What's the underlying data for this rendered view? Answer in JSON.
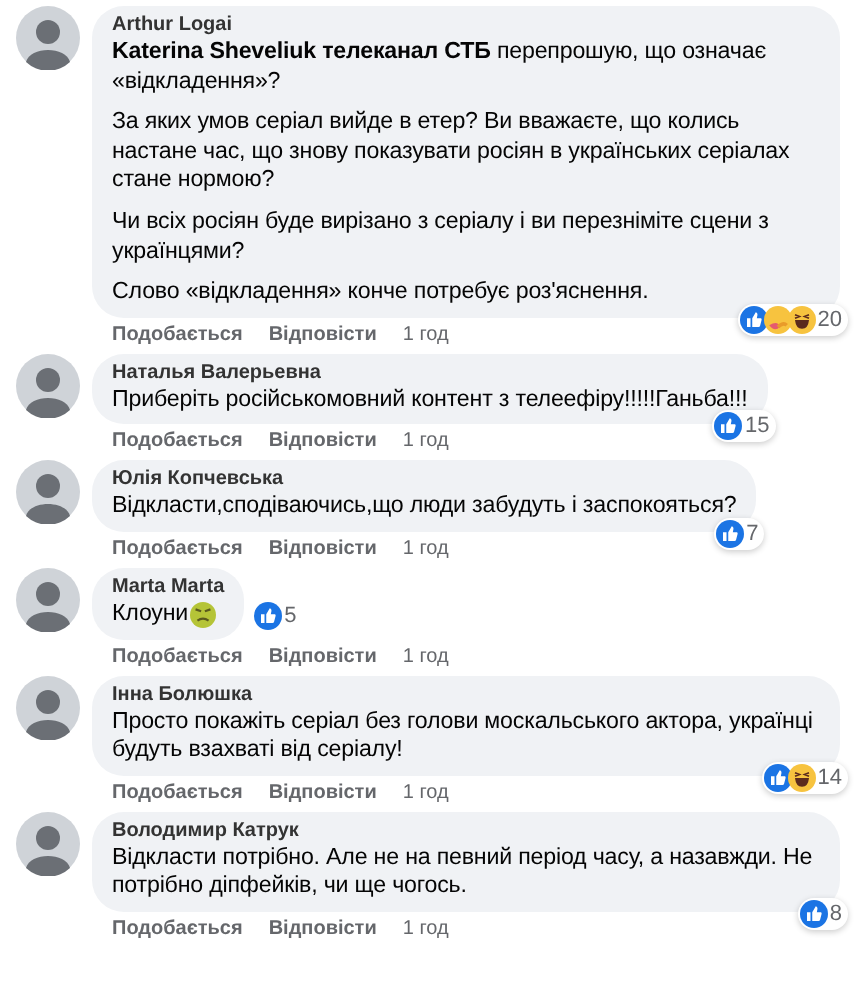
{
  "comments": [
    {
      "author": "Arthur Logai",
      "paragraphs": [
        "**Katerina Sheveliuk телеканал СТБ** перепрошую, що означає «відкладення»?",
        "За яких умов серіал вийде в етер? Ви вважаєте, що колись настане час, що знову показувати росіян в українських серіалах стане нормою?",
        "Чи всіх росіян буде вирізано з серіалу і ви перезніміте сцени з українцями?",
        "Слово «відкладення» конче потребує роз'яснення."
      ],
      "reactions": [
        {
          "kind": "like"
        },
        {
          "kind": "care"
        },
        {
          "kind": "haha"
        }
      ],
      "reaction_count": "20",
      "reactions_beside": false,
      "actions": [
        "Подобається",
        "Відповісти",
        "1 год"
      ]
    },
    {
      "author": "Наталья Валерьевна",
      "paragraphs": [
        "Приберіть російськомовний контент з телеефіру!!!!!Ганьба!!!"
      ],
      "reactions": [
        {
          "kind": "like"
        }
      ],
      "reaction_count": "15",
      "reactions_beside": false,
      "actions": [
        "Подобається",
        "Відповісти",
        "1 год"
      ]
    },
    {
      "author": "Юлія Копчевська",
      "paragraphs": [
        "Відкласти,сподіваючись,що люди забудуть і заспокояться?"
      ],
      "reactions": [
        {
          "kind": "like"
        }
      ],
      "reaction_count": "7",
      "reactions_beside": false,
      "actions": [
        "Подобається",
        "Відповісти",
        "1 год"
      ]
    },
    {
      "author": "Marta Marta",
      "paragraphs": [
        "Клоуни"
      ],
      "trailing_emoji": true,
      "reactions": [
        {
          "kind": "like"
        }
      ],
      "reaction_count": "5",
      "reactions_beside": true,
      "actions": [
        "Подобається",
        "Відповісти",
        "1 год"
      ]
    },
    {
      "author": "Інна Болюшка",
      "paragraphs": [
        "Просто покажіть серіал без голови москальського актора, українці будуть взахваті від серіалу!"
      ],
      "reactions": [
        {
          "kind": "like"
        },
        {
          "kind": "haha"
        }
      ],
      "reaction_count": "14",
      "reactions_beside": false,
      "actions": [
        "Подобається",
        "Відповісти",
        "1 год"
      ]
    },
    {
      "author": "Володимир Катрук",
      "paragraphs": [
        "Відкласти потрібно. Але не на певний період часу, а назавжди. Не потрібно діпфейків, чи ще чогось."
      ],
      "reactions": [
        {
          "kind": "like"
        }
      ],
      "reaction_count": "8",
      "reactions_beside": false,
      "actions": [
        "Подобається",
        "Відповісти",
        "1 год"
      ]
    }
  ]
}
